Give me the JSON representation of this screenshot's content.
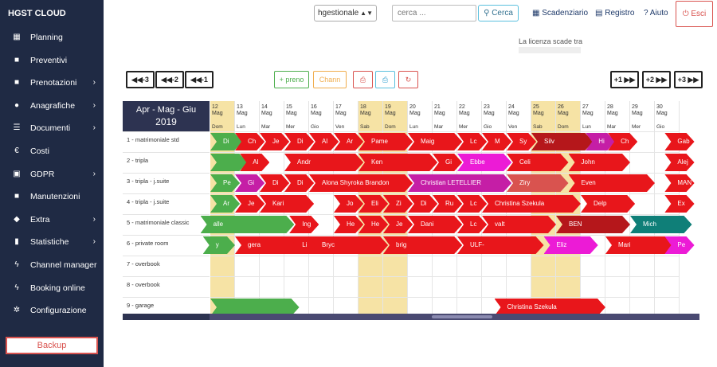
{
  "app": {
    "brand": "HGST CLOUD"
  },
  "sidebar": {
    "items": [
      {
        "label": "Planning",
        "icon": "calendar-icon",
        "glyph": "▦",
        "chevron": false
      },
      {
        "label": "Preventivi",
        "icon": "folder-icon",
        "glyph": "■",
        "chevron": false
      },
      {
        "label": "Prenotazioni",
        "icon": "folder-icon",
        "glyph": "■",
        "chevron": true
      },
      {
        "label": "Anagrafiche",
        "icon": "user-icon",
        "glyph": "●",
        "chevron": true
      },
      {
        "label": "Documenti",
        "icon": "list-icon",
        "glyph": "☰",
        "chevron": true
      },
      {
        "label": "Costi",
        "icon": "euro-icon",
        "glyph": "€",
        "chevron": false
      },
      {
        "label": "GDPR",
        "icon": "id-card-icon",
        "glyph": "▣",
        "chevron": true
      },
      {
        "label": "Manutenzioni",
        "icon": "folder-icon",
        "glyph": "■",
        "chevron": false
      },
      {
        "label": "Extra",
        "icon": "diamond-icon",
        "glyph": "◆",
        "chevron": true
      },
      {
        "label": "Statistiche",
        "icon": "bar-chart-icon",
        "glyph": "▮",
        "chevron": true
      },
      {
        "label": "Channel manager",
        "icon": "bolt-icon",
        "glyph": "ϟ",
        "chevron": false
      },
      {
        "label": "Booking online",
        "icon": "bolt-icon",
        "glyph": "ϟ",
        "chevron": false
      },
      {
        "label": "Configurazione",
        "icon": "cogs-icon",
        "glyph": "✲",
        "chevron": false
      }
    ],
    "backup_label": "Backup"
  },
  "topbar": {
    "property_select": "hgestionale",
    "search_placeholder": "cerca ...",
    "search_button": "Cerca",
    "scadenziario": "Scadenziario",
    "registro": "Registro",
    "aiuto": "Aiuto",
    "esci": "Esci",
    "license_text": "La licenza scade tra"
  },
  "controls": {
    "back3": "◀◀-3",
    "back2": "◀◀-2",
    "back1": "◀◀-1",
    "new_booking": "+ preno",
    "channel": "Chann",
    "fwd1": "+1 ▶▶",
    "fwd2": "+2 ▶▶",
    "fwd3": "+3 ▶▶"
  },
  "calendar": {
    "title_line1": "Apr - Mag - Giu",
    "title_line2": "2019",
    "days": [
      {
        "d": "12",
        "m": "Mag",
        "w": "Dom",
        "we": true
      },
      {
        "d": "13",
        "m": "Mag",
        "w": "Lun",
        "we": false
      },
      {
        "d": "14",
        "m": "Mag",
        "w": "Mar",
        "we": false
      },
      {
        "d": "15",
        "m": "Mag",
        "w": "Mer",
        "we": false
      },
      {
        "d": "16",
        "m": "Mag",
        "w": "Gio",
        "we": false
      },
      {
        "d": "17",
        "m": "Mag",
        "w": "Ven",
        "we": false
      },
      {
        "d": "18",
        "m": "Mag",
        "w": "Sab",
        "we": true
      },
      {
        "d": "19",
        "m": "Mag",
        "w": "Dom",
        "we": true
      },
      {
        "d": "20",
        "m": "Mag",
        "w": "Lun",
        "we": false
      },
      {
        "d": "21",
        "m": "Mag",
        "w": "Mar",
        "we": false
      },
      {
        "d": "22",
        "m": "Mag",
        "w": "Mer",
        "we": false
      },
      {
        "d": "23",
        "m": "Mag",
        "w": "Gio",
        "we": false
      },
      {
        "d": "24",
        "m": "Mag",
        "w": "Ven",
        "we": false
      },
      {
        "d": "25",
        "m": "Mag",
        "w": "Sab",
        "we": true
      },
      {
        "d": "26",
        "m": "Mag",
        "w": "Dom",
        "we": true
      },
      {
        "d": "27",
        "m": "Mag",
        "w": "Lun",
        "we": false
      },
      {
        "d": "28",
        "m": "Mag",
        "w": "Mar",
        "we": false
      },
      {
        "d": "29",
        "m": "Mag",
        "w": "Mer",
        "we": false
      },
      {
        "d": "30",
        "m": "Mag",
        "w": "Gio",
        "we": false
      }
    ],
    "rooms": [
      "1 - matrimoniale std",
      "2 - tripla",
      "3 - tripla - j.suite",
      "4 - tripla - j.suite",
      "5 - matrimoniale classic",
      "6 - private room",
      "7 - overbook",
      "8 - overbook",
      "9 - garage"
    ],
    "colors": {
      "red": "#e8161b",
      "darkred": "#b5171b",
      "green": "#4cae4c",
      "magenta": "#c51ea6",
      "pink": "#ec1bd6",
      "teal": "#0f7f78",
      "salmon": "#d9534f"
    },
    "bookings": [
      {
        "row": 0,
        "start": 0,
        "len": 1.3,
        "label": "Di",
        "color": "green"
      },
      {
        "row": 0,
        "start": 1.0,
        "len": 1.2,
        "label": "Ch",
        "color": "red"
      },
      {
        "row": 0,
        "start": 2.0,
        "len": 1.2,
        "label": "Je",
        "color": "red"
      },
      {
        "row": 0,
        "start": 3.0,
        "len": 1.2,
        "label": "Di",
        "color": "red"
      },
      {
        "row": 0,
        "start": 4.0,
        "len": 1.2,
        "label": "Al",
        "color": "red"
      },
      {
        "row": 0,
        "start": 5.0,
        "len": 1.2,
        "label": "Ar",
        "color": "red"
      },
      {
        "row": 0,
        "start": 6.0,
        "len": 2.2,
        "label": "Pame",
        "color": "red"
      },
      {
        "row": 0,
        "start": 8.0,
        "len": 2.2,
        "label": "Maig",
        "color": "red"
      },
      {
        "row": 0,
        "start": 10.0,
        "len": 1.2,
        "label": "Lc",
        "color": "red"
      },
      {
        "row": 0,
        "start": 11.0,
        "len": 1.2,
        "label": "M",
        "color": "red"
      },
      {
        "row": 0,
        "start": 12.0,
        "len": 1.2,
        "label": "Sy",
        "color": "red"
      },
      {
        "row": 0,
        "start": 13.0,
        "len": 2.5,
        "label": "Silv",
        "color": "darkred"
      },
      {
        "row": 0,
        "start": 15.2,
        "len": 1.2,
        "label": "Hi",
        "color": "magenta"
      },
      {
        "row": 0,
        "start": 16.1,
        "len": 1.2,
        "label": "Ch",
        "color": "red"
      },
      {
        "row": 0,
        "start": 18.4,
        "len": 1.2,
        "label": "Gab",
        "color": "red"
      },
      {
        "row": 1,
        "start": 0,
        "len": 1.5,
        "label": "",
        "color": "green"
      },
      {
        "row": 1,
        "start": 1.2,
        "len": 1.2,
        "label": "Al",
        "color": "red"
      },
      {
        "row": 1,
        "start": 3.0,
        "len": 3.2,
        "label": "Andr",
        "color": "red"
      },
      {
        "row": 1,
        "start": 6.0,
        "len": 3.2,
        "label": "Ken",
        "color": "red"
      },
      {
        "row": 1,
        "start": 9.0,
        "len": 1.2,
        "label": "Gi",
        "color": "red"
      },
      {
        "row": 1,
        "start": 10.0,
        "len": 2.2,
        "label": "Ebbe",
        "color": "pink"
      },
      {
        "row": 1,
        "start": 12.0,
        "len": 2.5,
        "label": "Celi",
        "color": "red"
      },
      {
        "row": 1,
        "start": 14.5,
        "len": 2.5,
        "label": "John",
        "color": "red"
      },
      {
        "row": 1,
        "start": 18.4,
        "len": 1.2,
        "label": "Alej",
        "color": "red"
      },
      {
        "row": 2,
        "start": 0,
        "len": 1.2,
        "label": "Pe",
        "color": "green"
      },
      {
        "row": 2,
        "start": 1.0,
        "len": 1.2,
        "label": "Gi",
        "color": "magenta"
      },
      {
        "row": 2,
        "start": 2.0,
        "len": 1.2,
        "label": "Di",
        "color": "red"
      },
      {
        "row": 2,
        "start": 3.0,
        "len": 1.2,
        "label": "Di",
        "color": "red"
      },
      {
        "row": 2,
        "start": 4.0,
        "len": 4.2,
        "label": "Alona Shyroka Brandon",
        "color": "red"
      },
      {
        "row": 2,
        "start": 8.0,
        "len": 4.2,
        "label": "Christian LETELLIER",
        "color": "magenta"
      },
      {
        "row": 2,
        "start": 12.0,
        "len": 2.5,
        "label": "Ziry",
        "color": "salmon"
      },
      {
        "row": 2,
        "start": 14.5,
        "len": 3.5,
        "label": "Even",
        "color": "red"
      },
      {
        "row": 2,
        "start": 18.4,
        "len": 1.2,
        "label": "MAN",
        "color": "red"
      },
      {
        "row": 3,
        "start": 0,
        "len": 1.2,
        "label": "Ar",
        "color": "green"
      },
      {
        "row": 3,
        "start": 1.0,
        "len": 1.2,
        "label": "Je",
        "color": "red"
      },
      {
        "row": 3,
        "start": 2.0,
        "len": 2.2,
        "label": "Kari",
        "color": "red"
      },
      {
        "row": 3,
        "start": 5.0,
        "len": 1.2,
        "label": "Jo",
        "color": "red"
      },
      {
        "row": 3,
        "start": 6.0,
        "len": 1.2,
        "label": "Eli",
        "color": "red"
      },
      {
        "row": 3,
        "start": 7.0,
        "len": 1.2,
        "label": "Zi",
        "color": "red"
      },
      {
        "row": 3,
        "start": 8.0,
        "len": 1.2,
        "label": "Di",
        "color": "red"
      },
      {
        "row": 3,
        "start": 9.0,
        "len": 1.2,
        "label": "Ru",
        "color": "red"
      },
      {
        "row": 3,
        "start": 10.0,
        "len": 1.2,
        "label": "Lc",
        "color": "red"
      },
      {
        "row": 3,
        "start": 11.0,
        "len": 4.0,
        "label": "Christina Szekula",
        "color": "red"
      },
      {
        "row": 3,
        "start": 15.0,
        "len": 2.2,
        "label": "Delp",
        "color": "red"
      },
      {
        "row": 3,
        "start": 18.4,
        "len": 1.2,
        "label": "Ex",
        "color": "red"
      },
      {
        "row": 4,
        "start": -0.4,
        "len": 3.8,
        "label": "alle",
        "color": "green"
      },
      {
        "row": 4,
        "start": 3.2,
        "len": 1.2,
        "label": "Ing",
        "color": "red"
      },
      {
        "row": 4,
        "start": 5.0,
        "len": 1.2,
        "label": "He",
        "color": "red"
      },
      {
        "row": 4,
        "start": 6.0,
        "len": 1.2,
        "label": "He",
        "color": "red"
      },
      {
        "row": 4,
        "start": 7.0,
        "len": 1.2,
        "label": "Je",
        "color": "red"
      },
      {
        "row": 4,
        "start": 8.0,
        "len": 2.2,
        "label": "Dani",
        "color": "red"
      },
      {
        "row": 4,
        "start": 10.0,
        "len": 1.2,
        "label": "Lc",
        "color": "red"
      },
      {
        "row": 4,
        "start": 11.0,
        "len": 3.0,
        "label": "valt",
        "color": "red"
      },
      {
        "row": 4,
        "start": 14.0,
        "len": 3.0,
        "label": "BEN",
        "color": "darkred"
      },
      {
        "row": 4,
        "start": 17.0,
        "len": 2.5,
        "label": "Mich",
        "color": "teal"
      },
      {
        "row": 5,
        "start": -0.3,
        "len": 1.3,
        "label": "y",
        "color": "green"
      },
      {
        "row": 5,
        "start": 1.0,
        "len": 3.0,
        "label": "gera",
        "color": "red"
      },
      {
        "row": 5,
        "start": 3.2,
        "len": 1.2,
        "label": "Li",
        "color": "red"
      },
      {
        "row": 5,
        "start": 4.0,
        "len": 3.2,
        "label": "Bryc",
        "color": "red"
      },
      {
        "row": 5,
        "start": 7.0,
        "len": 3.2,
        "label": "brig",
        "color": "red"
      },
      {
        "row": 5,
        "start": 10.0,
        "len": 3.5,
        "label": "ULF-",
        "color": "red"
      },
      {
        "row": 5,
        "start": 13.5,
        "len": 2.2,
        "label": "Eliz",
        "color": "pink"
      },
      {
        "row": 5,
        "start": 16.0,
        "len": 3.0,
        "label": "Mari",
        "color": "red"
      },
      {
        "row": 5,
        "start": 18.4,
        "len": 1.2,
        "label": "Pe",
        "color": "pink"
      },
      {
        "row": 8,
        "start": 0,
        "len": 3.6,
        "label": "",
        "color": "green"
      },
      {
        "row": 8,
        "start": 11.5,
        "len": 4.5,
        "label": "Christina Szekula",
        "color": "red"
      }
    ]
  }
}
